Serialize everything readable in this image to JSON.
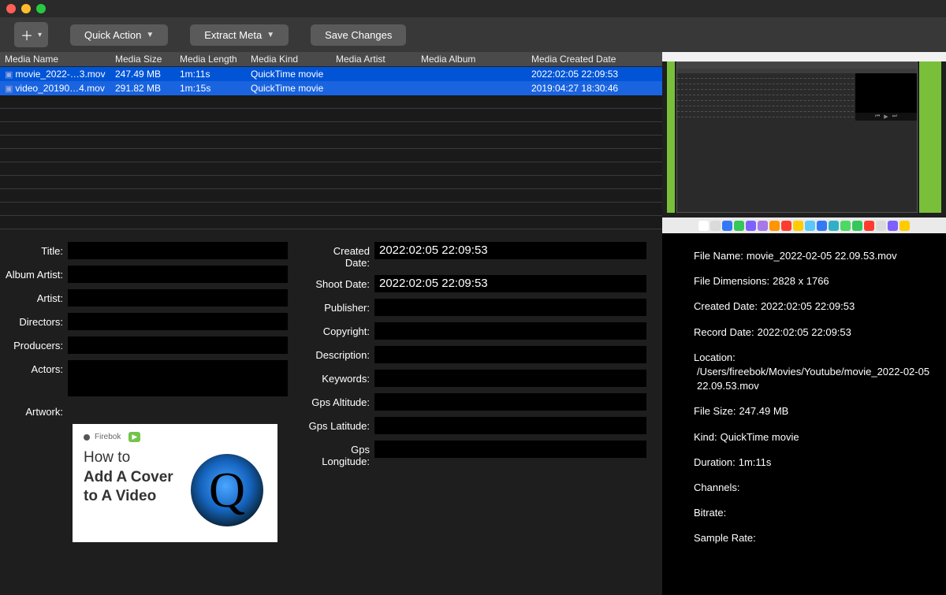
{
  "toolbar": {
    "add_label": "＋",
    "quick_action_label": "Quick Action",
    "extract_meta_label": "Extract Meta",
    "save_changes_label": "Save Changes"
  },
  "table": {
    "headers": {
      "name": "Media Name",
      "size": "Media Size",
      "length": "Media Length",
      "kind": "Media Kind",
      "artist": "Media Artist",
      "album": "Media Album",
      "created": "Media Created Date"
    },
    "rows": [
      {
        "name": "movie_2022-…3.mov",
        "size": "247.49 MB",
        "length": "1m:11s",
        "kind": "QuickTime movie",
        "artist": "",
        "album": "",
        "created": "2022:02:05 22:09:53"
      },
      {
        "name": "video_20190…4.mov",
        "size": "291.82 MB",
        "length": "1m:15s",
        "kind": "QuickTime movie",
        "artist": "",
        "album": "",
        "created": "2019:04:27 18:30:46"
      }
    ]
  },
  "form": {
    "labels": {
      "title": "Title:",
      "album_artist": "Album Artist:",
      "artist": "Artist:",
      "directors": "Directors:",
      "producers": "Producers:",
      "actors": "Actors:",
      "artwork": "Artwork:",
      "created_date": "Created Date:",
      "shoot_date": "Shoot Date:",
      "publisher": "Publisher:",
      "copyright": "Copyright:",
      "description": "Description:",
      "keywords": "Keywords:",
      "gps_alt": "Gps Altitude:",
      "gps_lat": "Gps Latitude:",
      "gps_lon": "Gps Longitude:"
    },
    "values": {
      "created_date": "2022:02:05 22:09:53",
      "shoot_date": "2022:02:05 22:09:53"
    },
    "artwork": {
      "brand": "Firebok",
      "line1": "How to",
      "line2a": "Add A Cover",
      "line2b": "to A Video"
    }
  },
  "info": {
    "file_name_label": "File Name:",
    "file_name": "movie_2022-02-05 22.09.53.mov",
    "dimensions_label": "File Dimensions:",
    "dimensions": "2828 x 1766",
    "created_label": "Created Date:",
    "created": "2022:02:05 22:09:53",
    "record_label": "Record Date:",
    "record": "2022:02:05 22:09:53",
    "location_label": "Location:",
    "location": "/Users/fireebok/Movies/Youtube/movie_2022-02-05 22.09.53.mov",
    "size_label": "File Size:",
    "size": "247.49 MB",
    "kind_label": "Kind:",
    "kind": "QuickTime movie",
    "duration_label": "Duration:",
    "duration": "1m:11s",
    "channels_label": "Channels:",
    "channels": "",
    "bitrate_label": "Bitrate:",
    "bitrate": "",
    "sample_label": "Sample Rate:",
    "sample": ""
  }
}
